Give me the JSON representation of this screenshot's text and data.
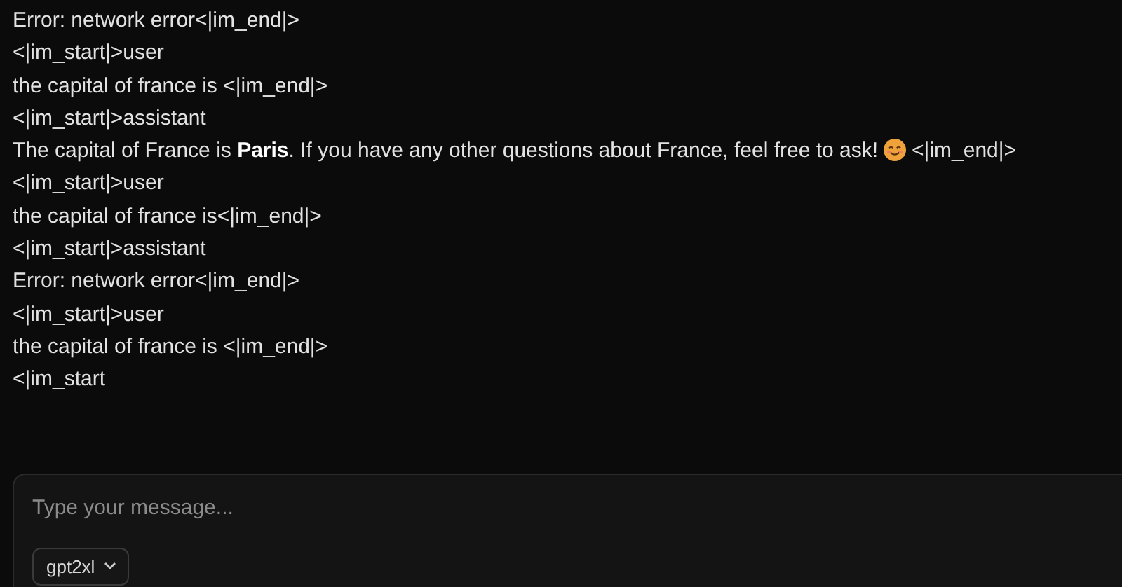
{
  "messages": [
    {
      "kind": "plain",
      "text": "Error: network error<|im_end|>"
    },
    {
      "kind": "plain",
      "text": "<|im_start|>user"
    },
    {
      "kind": "plain",
      "text": "the capital of france is <|im_end|>"
    },
    {
      "kind": "plain",
      "text": "<|im_start|>assistant"
    },
    {
      "kind": "emoji",
      "text": "The capital of France is **Paris**. If you have any other questions about France, feel free to ask!",
      "tail": "<|im_end|>"
    },
    {
      "kind": "plain",
      "text": "<|im_start|>user"
    },
    {
      "kind": "plain",
      "text": "the capital of france is<|im_end|>"
    },
    {
      "kind": "plain",
      "text": "<|im_start|>assistant"
    },
    {
      "kind": "plain",
      "text": "Error: network error<|im_end|>"
    },
    {
      "kind": "plain",
      "text": "<|im_start|>user"
    },
    {
      "kind": "plain",
      "text": "the capital of france is <|im_end|>"
    },
    {
      "kind": "plain",
      "text": "<|im_start"
    }
  ],
  "composer": {
    "placeholder": "Type your message...",
    "model": "gpt2xl"
  }
}
